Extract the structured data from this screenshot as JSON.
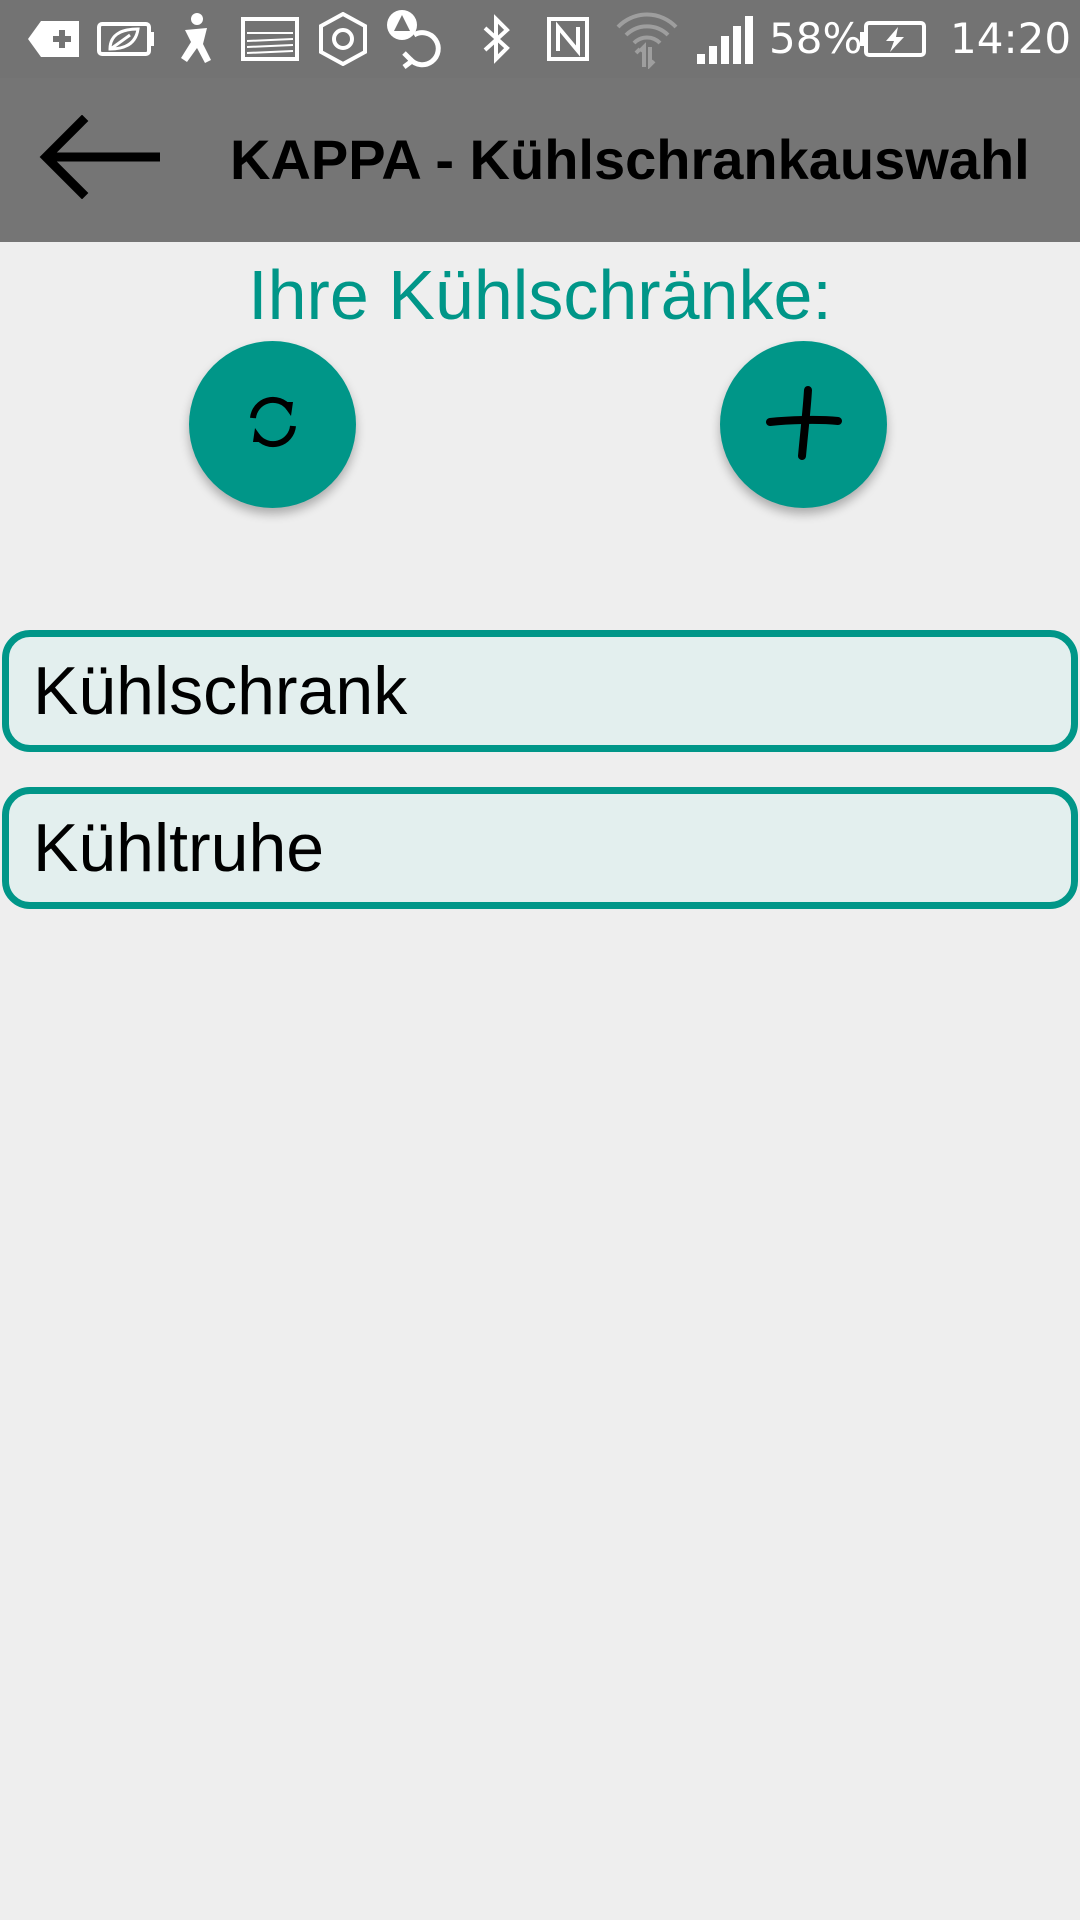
{
  "status_bar": {
    "icons": [
      "notification-add-icon",
      "eco-battery-icon",
      "accessibility-icon",
      "image-icon",
      "hexagon-settings-icon",
      "sync-alert-icon",
      "bluetooth-icon",
      "nfc-icon",
      "wifi-icon",
      "cellular-signal-icon",
      "battery-charging-icon"
    ],
    "battery_percent": "58%",
    "time": "14:20",
    "icon_color": "#ffffff"
  },
  "app_bar": {
    "back_icon": "arrow-left-icon",
    "title": "KAPPA - Kühlschrankauswahl",
    "background": "#757575"
  },
  "main": {
    "heading": "Ihre Kühlschränke:",
    "accent_color": "#009688",
    "refresh_icon": "refresh-icon",
    "add_icon": "plus-icon",
    "fridges": [
      {
        "label": "Kühlschrank"
      },
      {
        "label": "Kühltruhe"
      }
    ]
  }
}
